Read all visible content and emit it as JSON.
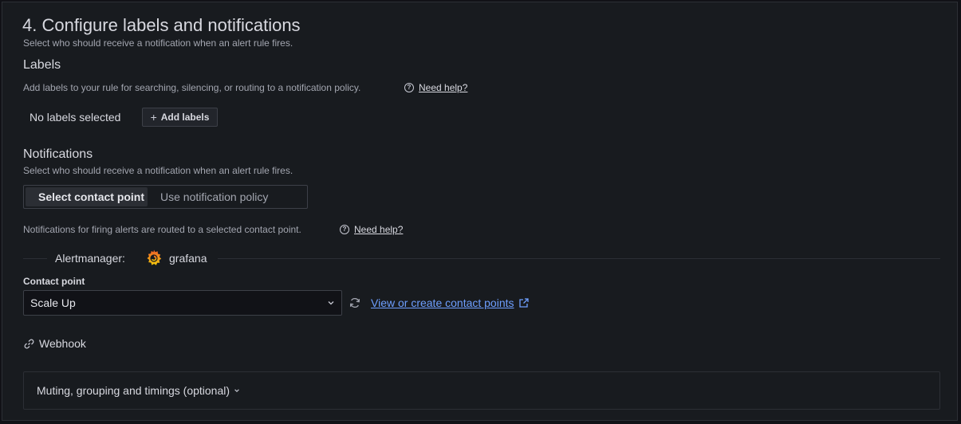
{
  "section": {
    "title": "4. Configure labels and notifications",
    "subtitle": "Select who should receive a notification when an alert rule fires."
  },
  "labels": {
    "heading": "Labels",
    "description": "Add labels to your rule for searching, silencing, or routing to a notification policy.",
    "help_link": "Need help?",
    "empty_text": "No labels selected",
    "add_button": "Add labels"
  },
  "notifications": {
    "heading": "Notifications",
    "description": "Select who should receive a notification when an alert rule fires.",
    "options": [
      {
        "label": "Select contact point",
        "active": true
      },
      {
        "label": "Use notification policy",
        "active": false
      }
    ],
    "routing_text": "Notifications for firing alerts are routed to a selected contact point.",
    "help_link": "Need help?"
  },
  "alertmanager": {
    "label": "Alertmanager:",
    "name": "grafana",
    "icon": "grafana-logo-icon"
  },
  "contact_point": {
    "label": "Contact point",
    "value": "Scale Up",
    "view_link": "View or create contact points",
    "integration": "Webhook"
  },
  "muting": {
    "label": "Muting, grouping and timings (optional)"
  },
  "colors": {
    "background": "#181b1f",
    "link": "#6e9fff",
    "text": "#d8d9e0"
  }
}
